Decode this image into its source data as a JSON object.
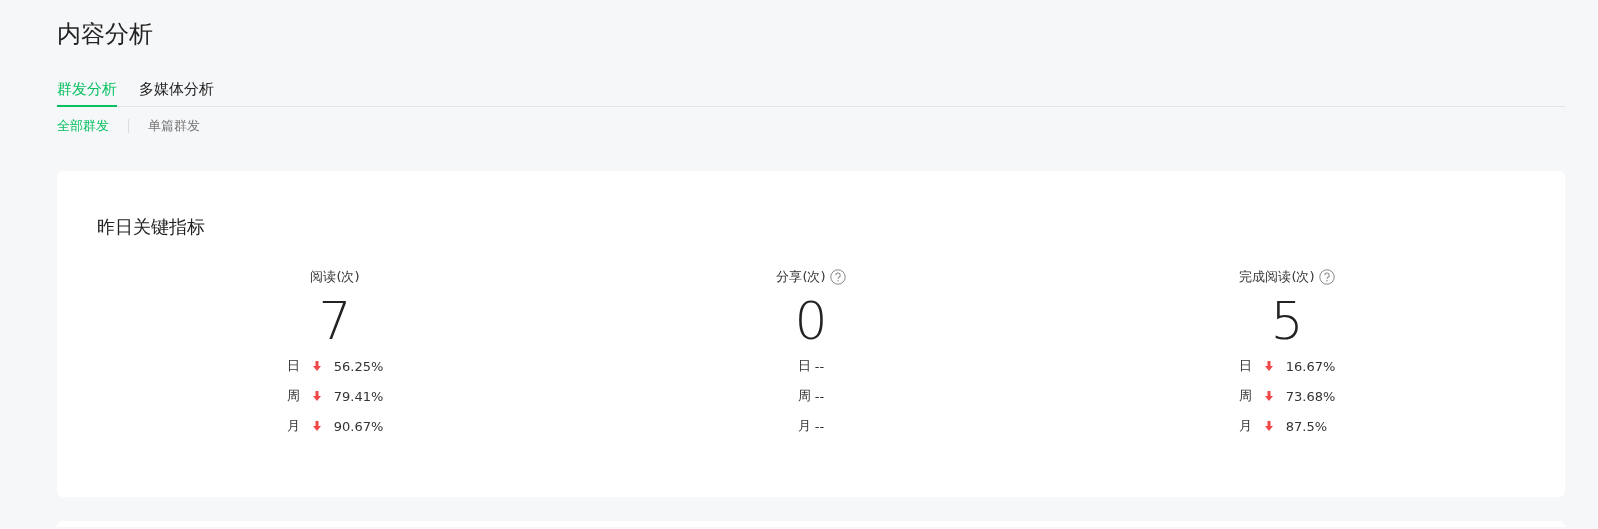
{
  "page_title": "内容分析",
  "tabs": [
    {
      "label": "群发分析",
      "selected": true
    },
    {
      "label": "多媒体分析",
      "selected": false
    }
  ],
  "sub_tabs": [
    {
      "label": "全部群发",
      "selected": true
    },
    {
      "label": "单篇群发",
      "selected": false
    }
  ],
  "card": {
    "title": "昨日关键指标",
    "metrics": [
      {
        "label": "阅读(次)",
        "help": false,
        "value": "7",
        "changes": [
          {
            "period": "日",
            "kind": "down",
            "value": "56.25%"
          },
          {
            "period": "周",
            "kind": "down",
            "value": "79.41%"
          },
          {
            "period": "月",
            "kind": "down",
            "value": "90.67%"
          }
        ]
      },
      {
        "label": "分享(次)",
        "help": true,
        "value": "0",
        "changes": [
          {
            "period": "日",
            "kind": "none",
            "value": "--"
          },
          {
            "period": "周",
            "kind": "none",
            "value": "--"
          },
          {
            "period": "月",
            "kind": "none",
            "value": "--"
          }
        ]
      },
      {
        "label": "完成阅读(次)",
        "help": true,
        "value": "5",
        "changes": [
          {
            "period": "日",
            "kind": "down",
            "value": "16.67%"
          },
          {
            "period": "周",
            "kind": "down",
            "value": "73.68%"
          },
          {
            "period": "月",
            "kind": "down",
            "value": "87.5%"
          }
        ]
      }
    ]
  }
}
